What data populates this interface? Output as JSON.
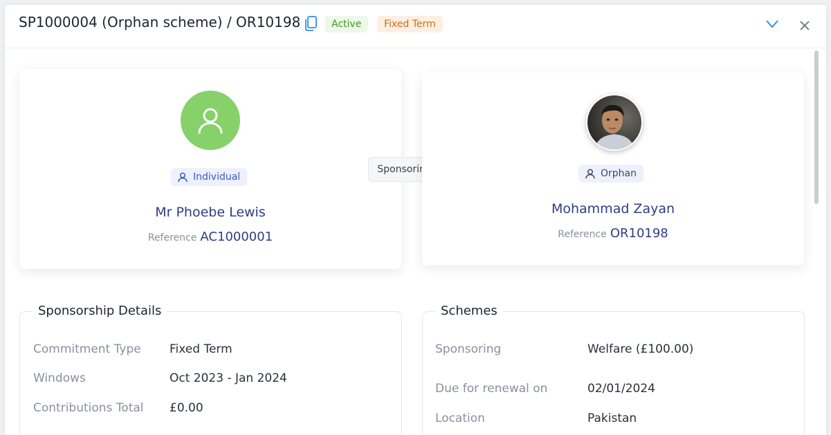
{
  "header": {
    "title": "SP1000004 (Orphan scheme) / OR10198",
    "status_badge": "Active",
    "term_badge": "Fixed Term"
  },
  "sponsor": {
    "role": "Individual",
    "name": "Mr Phoebe Lewis",
    "reference_label": "Reference",
    "reference": "AC1000001"
  },
  "relation": {
    "label": "Sponsoring"
  },
  "beneficiary": {
    "role": "Orphan",
    "name": "Mohammad Zayan",
    "reference_label": "Reference",
    "reference": "OR10198"
  },
  "sponsorship_details": {
    "title": "Sponsorship Details",
    "rows": [
      {
        "label": "Commitment Type",
        "value": "Fixed Term"
      },
      {
        "label": "Windows",
        "value": "Oct 2023 - Jan 2024"
      },
      {
        "label": "Contributions Total",
        "value": "£0.00"
      }
    ]
  },
  "schemes": {
    "title": "Schemes",
    "rows": [
      {
        "label": "Sponsoring",
        "value": "Welfare (£100.00)"
      },
      {
        "label": "Due for renewal on",
        "value": "02/01/2024"
      },
      {
        "label": "Location",
        "value": "Pakistan"
      }
    ]
  },
  "icons": {
    "copy": "copy-icon",
    "collapse": "chevron-down-icon",
    "close": "close-icon",
    "person": "user-icon",
    "arrow": "arrow-right-icon"
  },
  "colors": {
    "accent": "#2e3d83",
    "active_badge_bg": "#eef8e8",
    "active_badge_text": "#3f9b1e",
    "fixed_badge_bg": "#fdf0e2",
    "fixed_badge_text": "#d36b12",
    "avatar_green": "#86d16a",
    "icon_blue": "#2d8ee6"
  }
}
